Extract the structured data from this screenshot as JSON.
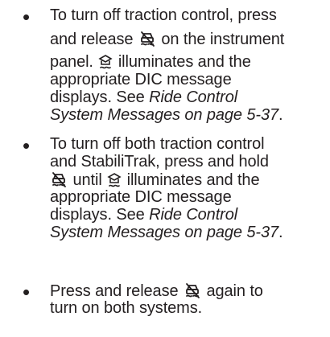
{
  "bullet_glyph": "•",
  "icons": {
    "traction_button": "traction-control-off-icon",
    "stabilitrak_light": "stabilitrak-off-light-icon"
  },
  "items": [
    {
      "lines": [
        {
          "text": "To turn off traction control, press"
        },
        {
          "before": "and release",
          "after": "on the instrument"
        },
        {
          "before": "panel.",
          "after": "illuminates and the"
        },
        {
          "text": "appropriate DIC message"
        },
        {
          "before": "displays. See",
          "italic": "Ride Control"
        },
        {
          "italic": "System Messages on page 5-37",
          "after": "."
        }
      ]
    },
    {
      "lines": [
        {
          "text": "To turn off both traction control"
        },
        {
          "text": "and StabiliTrak, press and hold"
        },
        {
          "before": "",
          "mid": "until",
          "after": "illuminates and the"
        },
        {
          "text": "appropriate DIC message"
        },
        {
          "before": "displays. See",
          "italic": "Ride Control"
        },
        {
          "italic": "System Messages on page 5-37",
          "after": "."
        }
      ]
    },
    {
      "lines": [
        {
          "before": "Press and release",
          "after": "again to"
        },
        {
          "text": "turn on both systems."
        }
      ]
    }
  ]
}
